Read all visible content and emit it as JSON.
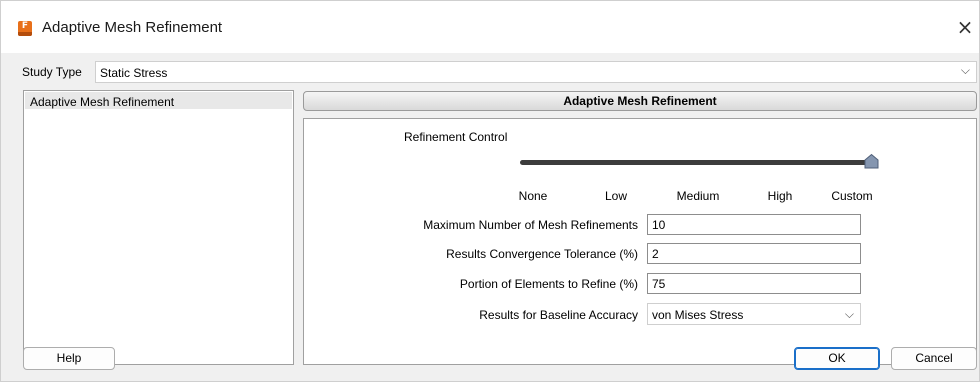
{
  "window": {
    "title": "Adaptive Mesh Refinement",
    "close_glyph": "×",
    "app_icon": "fusion-app-icon",
    "app_icon_glyph": "F",
    "accent_color": "#e8701a"
  },
  "study": {
    "label": "Study Type",
    "value": "Static Stress",
    "chevron": "⌵"
  },
  "left_panel": {
    "items": [
      {
        "label": "Adaptive Mesh Refinement",
        "selected": true
      }
    ]
  },
  "section": {
    "title": "Adaptive Mesh Refinement"
  },
  "refinement": {
    "label": "Refinement Control",
    "ticks": [
      "None",
      "Low",
      "Medium",
      "High",
      "Custom"
    ],
    "selected": "Custom"
  },
  "fields": {
    "max_refinements": {
      "label": "Maximum Number of Mesh Refinements",
      "value": "10"
    },
    "tolerance": {
      "label": "Results Convergence Tolerance (%)",
      "value": "2"
    },
    "portion": {
      "label": "Portion of Elements to Refine (%)",
      "value": "75"
    },
    "baseline": {
      "label": "Results for Baseline Accuracy",
      "value": "von Mises Stress",
      "chevron": "⌵"
    }
  },
  "buttons": {
    "help": "Help",
    "ok": "OK",
    "cancel": "Cancel"
  }
}
